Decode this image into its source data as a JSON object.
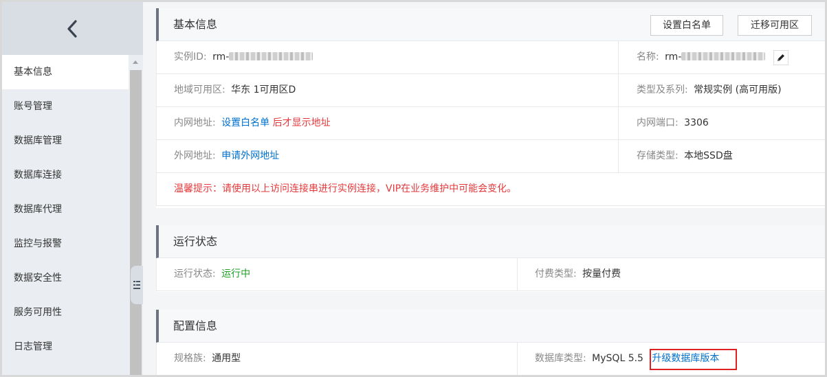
{
  "sidebar": {
    "back_icon": "chevron-left-icon",
    "items": [
      {
        "label": "基本信息",
        "active": true
      },
      {
        "label": "账号管理"
      },
      {
        "label": "数据库管理"
      },
      {
        "label": "数据库连接"
      },
      {
        "label": "数据库代理"
      },
      {
        "label": "监控与报警"
      },
      {
        "label": "数据安全性"
      },
      {
        "label": "服务可用性"
      },
      {
        "label": "日志管理"
      }
    ]
  },
  "basic": {
    "title": "基本信息",
    "whitelist_button": "设置白名单",
    "migrate_button": "迁移可用区",
    "instance_id_label": "实例ID:",
    "instance_id_prefix": "rm-",
    "name_label": "名称:",
    "name_prefix": "rm-",
    "zone_label": "地域可用区:",
    "zone_value": "华东 1可用区D",
    "type_label": "类型及系列:",
    "type_value": "常规实例 (高可用版)",
    "intranet_label": "内网地址:",
    "intranet_link": "设置白名单",
    "intranet_after": "后才显示地址",
    "intranet_port_label": "内网端口:",
    "intranet_port_value": "3306",
    "internet_label": "外网地址:",
    "internet_link": "申请外网地址",
    "storage_label": "存储类型:",
    "storage_value": "本地SSD盘",
    "warning": "温馨提示：请使用以上访问连接串进行实例连接，VIP在业务维护中可能会变化。"
  },
  "status": {
    "title": "运行状态",
    "run_label": "运行状态:",
    "run_value": "运行中",
    "pay_label": "付费类型:",
    "pay_value": "按量付费"
  },
  "config": {
    "title": "配置信息",
    "spec_label": "规格族:",
    "spec_value": "通用型",
    "db_type_label": "数据库类型:",
    "db_type_value": "MySQL 5.5",
    "upgrade_link": "升级数据库版本"
  },
  "colors": {
    "link": "#0070cc",
    "warning": "#e4393c",
    "running": "#1e9e25",
    "highlight_box": "#e02020"
  }
}
